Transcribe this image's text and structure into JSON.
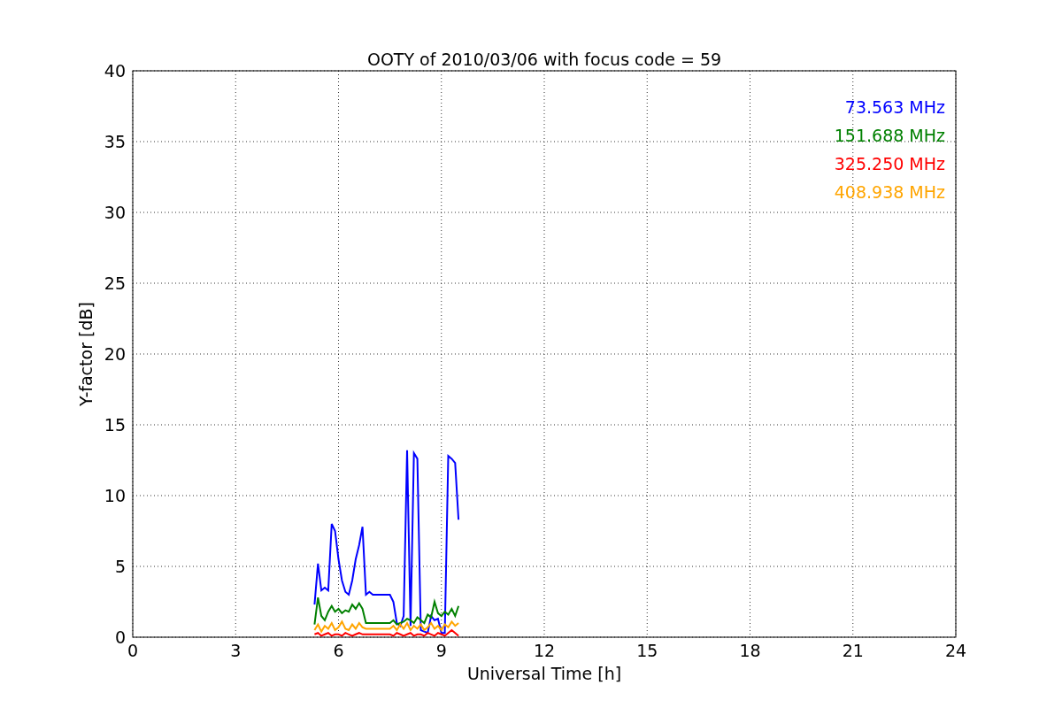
{
  "chart_data": {
    "type": "line",
    "title": "OOTY of 2010/03/06 with focus code = 59",
    "xlabel": "Universal Time [h]",
    "ylabel": "Y-factor [dB]",
    "x": [
      5.3,
      5.4,
      5.5,
      5.6,
      5.7,
      5.8,
      5.9,
      6.0,
      6.1,
      6.2,
      6.3,
      6.4,
      6.5,
      6.6,
      6.7,
      6.8,
      6.9,
      7.0,
      7.1,
      7.2,
      7.3,
      7.4,
      7.5,
      7.6,
      7.7,
      7.8,
      7.9,
      8.0,
      8.1,
      8.2,
      8.3,
      8.4,
      8.5,
      8.6,
      8.7,
      8.8,
      8.9,
      9.0,
      9.1,
      9.2,
      9.3,
      9.4,
      9.5
    ],
    "series": [
      {
        "name": "73.563 MHz",
        "color": "#0000ff",
        "values": [
          2.3,
          5.2,
          3.3,
          3.5,
          3.3,
          8.0,
          7.5,
          5.5,
          4.0,
          3.2,
          3.0,
          4.0,
          5.5,
          6.5,
          7.8,
          3.0,
          3.2,
          3.0,
          3.0,
          3.0,
          3.0,
          3.0,
          3.0,
          2.5,
          1.0,
          0.8,
          1.5,
          13.2,
          0.8,
          13.0,
          12.6,
          0.5,
          0.4,
          0.3,
          1.5,
          1.2,
          1.3,
          0.3,
          0.3,
          12.8,
          12.6,
          12.3,
          8.3
        ]
      },
      {
        "name": "151.688 MHz",
        "color": "#008000",
        "values": [
          0.9,
          2.8,
          1.5,
          1.2,
          1.8,
          2.2,
          1.8,
          2.0,
          1.7,
          1.9,
          1.8,
          2.3,
          2.0,
          2.4,
          2.0,
          1.0,
          1.0,
          1.0,
          1.0,
          1.0,
          1.0,
          1.0,
          1.0,
          1.2,
          0.9,
          1.0,
          1.1,
          1.3,
          1.2,
          1.0,
          1.4,
          1.2,
          1.0,
          1.6,
          1.4,
          2.5,
          1.7,
          1.5,
          1.8,
          1.6,
          2.0,
          1.5,
          2.2
        ]
      },
      {
        "name": "325.250 MHz",
        "color": "#ff0000",
        "values": [
          0.2,
          0.3,
          0.1,
          0.2,
          0.3,
          0.1,
          0.2,
          0.2,
          0.1,
          0.3,
          0.2,
          0.1,
          0.2,
          0.3,
          0.2,
          0.2,
          0.2,
          0.2,
          0.2,
          0.2,
          0.2,
          0.2,
          0.2,
          0.1,
          0.3,
          0.2,
          0.1,
          0.2,
          0.3,
          0.1,
          0.2,
          0.2,
          0.1,
          0.3,
          0.2,
          0.1,
          0.3,
          0.2,
          0.1,
          0.3,
          0.5,
          0.3,
          0.1
        ]
      },
      {
        "name": "408.938 MHz",
        "color": "#ffa500",
        "values": [
          0.5,
          0.9,
          0.4,
          0.8,
          0.6,
          1.0,
          0.5,
          0.7,
          1.1,
          0.6,
          0.5,
          0.9,
          0.6,
          1.0,
          0.7,
          0.6,
          0.6,
          0.6,
          0.6,
          0.6,
          0.6,
          0.6,
          0.6,
          0.8,
          0.5,
          0.9,
          0.6,
          1.0,
          0.5,
          0.8,
          0.6,
          0.9,
          0.5,
          0.7,
          1.0,
          0.6,
          0.8,
          0.5,
          0.9,
          0.7,
          1.1,
          0.8,
          1.0
        ]
      }
    ],
    "grid": true,
    "xlim": [
      0,
      24
    ],
    "ylim": [
      0,
      40
    ],
    "xticks": [
      0,
      3,
      6,
      9,
      12,
      15,
      18,
      21,
      24
    ],
    "yticks": [
      0,
      5,
      10,
      15,
      20,
      25,
      30,
      35,
      40
    ]
  }
}
